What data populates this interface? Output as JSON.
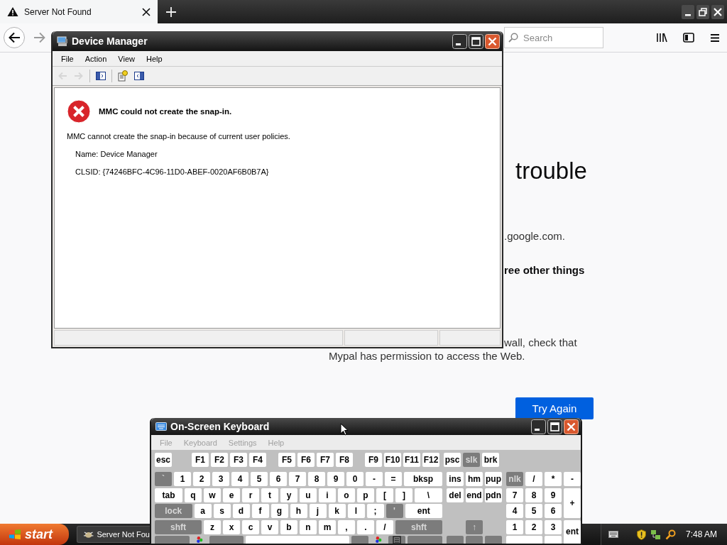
{
  "browser": {
    "tabs": [
      {
        "title": "Server Not Found",
        "selected": true
      }
    ],
    "search": {
      "placeholder": "Search"
    },
    "page": {
      "heading": "trouble",
      "lines": [
        {
          "text": ".google.com.",
          "kind": "plain"
        },
        {
          "text": "ree other things",
          "kind": "bold"
        },
        {
          "text": "wall, check that",
          "kind": "plain"
        },
        {
          "text": "Mypal has permission to access the Web.",
          "kind": "plain"
        }
      ],
      "button": "Try Again"
    }
  },
  "device_manager": {
    "title": "Device Manager",
    "menu": [
      "File",
      "Action",
      "View",
      "Help"
    ],
    "toolbar": [
      {
        "kind": "back",
        "disabled": true
      },
      {
        "kind": "forward",
        "disabled": true
      },
      {
        "kind": "tree",
        "disabled": false
      },
      {
        "kind": "properties",
        "disabled": false
      },
      {
        "kind": "pane",
        "disabled": false
      }
    ],
    "error": {
      "heading": "MMC could not create the snap-in.",
      "message": "MMC cannot create the snap-in because of current user policies.",
      "details": [
        "Name: Device Manager",
        "CLSID: {74246BFC-4C96-11D0-ABEF-0020AF6B0B7A}"
      ]
    }
  },
  "keyboard": {
    "title": "On-Screen Keyboard",
    "menu": [
      {
        "label": "File",
        "disabled": true
      },
      {
        "label": "Keyboard",
        "disabled": true
      },
      {
        "label": "Settings",
        "disabled": true
      },
      {
        "label": "Help",
        "disabled": true
      }
    ],
    "rows": [
      {
        "groups": [
          {
            "kind": "fn",
            "keys": [
              {
                "label": "esc",
                "kind": "key"
              }
            ]
          },
          {
            "kind": "fn",
            "keys": [
              {
                "label": "F1",
                "kind": "key"
              },
              {
                "label": "F2",
                "kind": "key"
              },
              {
                "label": "F3",
                "kind": "key"
              },
              {
                "label": "F4",
                "kind": "key"
              }
            ]
          },
          {
            "kind": "fn",
            "keys": [
              {
                "label": "F5",
                "kind": "key"
              },
              {
                "label": "F6",
                "kind": "key"
              },
              {
                "label": "F7",
                "kind": "key"
              },
              {
                "label": "F8",
                "kind": "key"
              }
            ]
          },
          {
            "kind": "fn",
            "keys": [
              {
                "label": "F9",
                "kind": "key"
              },
              {
                "label": "F10",
                "kind": "key"
              },
              {
                "label": "F11",
                "kind": "key"
              },
              {
                "label": "F12",
                "kind": "key"
              }
            ]
          },
          {
            "kind": "nav",
            "keys": [
              {
                "label": "psc",
                "kind": "key"
              },
              {
                "label": "slk",
                "kind": "grey"
              },
              {
                "label": "brk",
                "kind": "key"
              }
            ]
          }
        ]
      },
      {
        "groups": [
          {
            "kind": "main",
            "keys": [
              {
                "label": "`",
                "kind": "grey"
              },
              {
                "label": "1",
                "kind": "key"
              },
              {
                "label": "2",
                "kind": "key"
              },
              {
                "label": "3",
                "kind": "key"
              },
              {
                "label": "4",
                "kind": "key"
              },
              {
                "label": "5",
                "kind": "key"
              },
              {
                "label": "6",
                "kind": "key"
              },
              {
                "label": "7",
                "kind": "key"
              },
              {
                "label": "8",
                "kind": "key"
              },
              {
                "label": "9",
                "kind": "key"
              },
              {
                "label": "0",
                "kind": "key"
              },
              {
                "label": "-",
                "kind": "key"
              },
              {
                "label": "=",
                "kind": "key"
              },
              {
                "label": "bksp",
                "kind": "wide"
              }
            ]
          },
          {
            "kind": "nav",
            "keys": [
              {
                "label": "ins",
                "kind": "key"
              },
              {
                "label": "hm",
                "kind": "key"
              },
              {
                "label": "pup",
                "kind": "key"
              }
            ]
          },
          {
            "kind": "numpad",
            "keys": [
              {
                "label": "nlk",
                "kind": "grey"
              },
              {
                "label": "/",
                "kind": "key"
              },
              {
                "label": "*",
                "kind": "key"
              },
              {
                "label": "-",
                "kind": "key"
              }
            ]
          }
        ]
      },
      {
        "groups": [
          {
            "kind": "main",
            "keys": [
              {
                "label": "tab",
                "kind": "wide"
              },
              {
                "label": "q",
                "kind": "key"
              },
              {
                "label": "w",
                "kind": "key"
              },
              {
                "label": "e",
                "kind": "key"
              },
              {
                "label": "r",
                "kind": "key"
              },
              {
                "label": "t",
                "kind": "key"
              },
              {
                "label": "y",
                "kind": "key"
              },
              {
                "label": "u",
                "kind": "key"
              },
              {
                "label": "i",
                "kind": "key"
              },
              {
                "label": "o",
                "kind": "key"
              },
              {
                "label": "p",
                "kind": "key"
              },
              {
                "label": "[",
                "kind": "key"
              },
              {
                "label": "]",
                "kind": "key"
              },
              {
                "label": "\\",
                "kind": "wide"
              }
            ]
          },
          {
            "kind": "nav",
            "keys": [
              {
                "label": "del",
                "kind": "key"
              },
              {
                "label": "end",
                "kind": "key"
              },
              {
                "label": "pdn",
                "kind": "key"
              }
            ]
          },
          {
            "kind": "numpad",
            "keys": [
              {
                "label": "7",
                "kind": "key"
              },
              {
                "label": "8",
                "kind": "key"
              },
              {
                "label": "9",
                "kind": "key"
              },
              {
                "label": "+",
                "kind": "tall"
              }
            ]
          }
        ]
      },
      {
        "groups": [
          {
            "kind": "main",
            "keys": [
              {
                "label": "lock",
                "kind": "greywide"
              },
              {
                "label": "a",
                "kind": "key"
              },
              {
                "label": "s",
                "kind": "key"
              },
              {
                "label": "d",
                "kind": "key"
              },
              {
                "label": "f",
                "kind": "key"
              },
              {
                "label": "g",
                "kind": "key"
              },
              {
                "label": "h",
                "kind": "key"
              },
              {
                "label": "j",
                "kind": "key"
              },
              {
                "label": "k",
                "kind": "key"
              },
              {
                "label": "l",
                "kind": "key"
              },
              {
                "label": ";",
                "kind": "key"
              },
              {
                "label": "'",
                "kind": "grey"
              },
              {
                "label": "ent",
                "kind": "wide"
              }
            ]
          },
          {
            "kind": "nav"
          },
          {
            "kind": "numpad",
            "keys": [
              {
                "label": "4",
                "kind": "key"
              },
              {
                "label": "5",
                "kind": "key"
              },
              {
                "label": "6",
                "kind": "key"
              }
            ]
          }
        ]
      },
      {
        "groups": [
          {
            "kind": "main",
            "keys": [
              {
                "label": "shft",
                "kind": "greywide"
              },
              {
                "label": "z",
                "kind": "key"
              },
              {
                "label": "x",
                "kind": "key"
              },
              {
                "label": "c",
                "kind": "key"
              },
              {
                "label": "v",
                "kind": "key"
              },
              {
                "label": "b",
                "kind": "key"
              },
              {
                "label": "n",
                "kind": "key"
              },
              {
                "label": "m",
                "kind": "key"
              },
              {
                "label": ",",
                "kind": "key"
              },
              {
                "label": ".",
                "kind": "key"
              },
              {
                "label": "/",
                "kind": "key"
              },
              {
                "label": "shft",
                "kind": "greywide"
              }
            ]
          },
          {
            "kind": "nav",
            "keys": [
              {
                "label": "↑",
                "kind": "grey"
              }
            ]
          },
          {
            "kind": "numpad",
            "keys": [
              {
                "label": "1",
                "kind": "key"
              },
              {
                "label": "2",
                "kind": "key"
              },
              {
                "label": "3",
                "kind": "key"
              },
              {
                "label": "ent",
                "kind": "tall"
              }
            ]
          }
        ]
      },
      {
        "groups": [
          {
            "kind": "main",
            "keys": [
              {
                "kind": "greywide"
              },
              {
                "kind": "logo"
              },
              {
                "kind": "greywide"
              },
              {
                "kind": "space"
              },
              {
                "kind": "grey"
              },
              {
                "kind": "logo"
              },
              {
                "kind": "menu"
              },
              {
                "kind": "greywide"
              }
            ]
          },
          {
            "kind": "nav",
            "keys": [
              {
                "kind": "grey"
              },
              {
                "kind": "grey"
              },
              {
                "kind": "grey"
              }
            ]
          },
          {
            "kind": "numpad",
            "keys": [
              {
                "kind": "double"
              },
              {
                "kind": "key"
              }
            ]
          }
        ]
      }
    ]
  },
  "taskbar": {
    "start": "start",
    "tasks": [
      {
        "label": "Server Not Fou",
        "selected": false
      }
    ],
    "clock": "7:48 AM"
  }
}
